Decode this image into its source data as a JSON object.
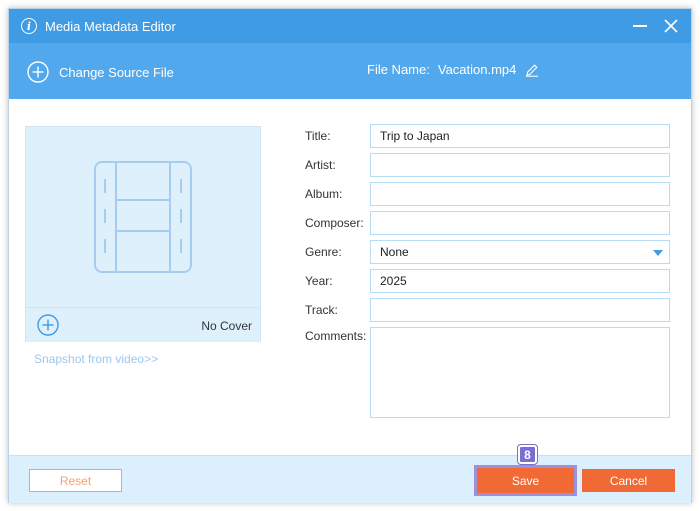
{
  "window": {
    "title": "Media Metadata Editor",
    "accent_color": "#3f9be4",
    "button_color": "#f16a35"
  },
  "toolbar": {
    "change_source_label": "Change Source File",
    "file_name_label": "File Name:",
    "file_name_value": "Vacation.mp4"
  },
  "cover": {
    "status": "No Cover",
    "snapshot_link": "Snapshot from video>>"
  },
  "form": {
    "title": {
      "label": "Title:",
      "value": "Trip to Japan"
    },
    "artist": {
      "label": "Artist:",
      "value": ""
    },
    "album": {
      "label": "Album:",
      "value": ""
    },
    "composer": {
      "label": "Composer:",
      "value": ""
    },
    "genre": {
      "label": "Genre:",
      "value": "None"
    },
    "year": {
      "label": "Year:",
      "value": "2025"
    },
    "track": {
      "label": "Track:",
      "value": ""
    },
    "comments": {
      "label": "Comments:",
      "value": ""
    }
  },
  "footer": {
    "reset_label": "Reset",
    "save_label": "Save",
    "cancel_label": "Cancel",
    "step_badge": "8"
  },
  "icons": [
    "info-icon",
    "minimize-icon",
    "close-icon",
    "add-circle-icon",
    "edit-pencil-icon",
    "film-icon",
    "dropdown-arrow-icon"
  ]
}
